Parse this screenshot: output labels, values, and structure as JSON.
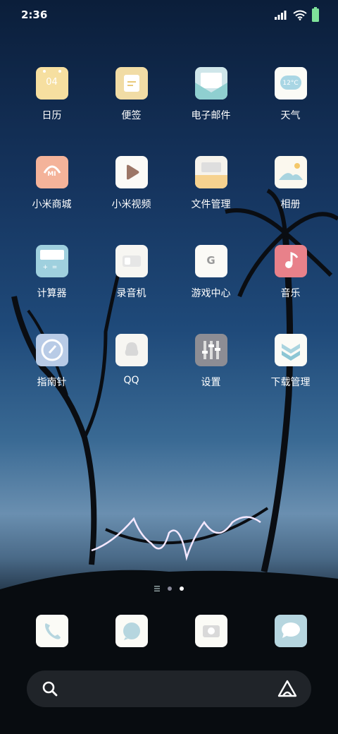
{
  "status": {
    "time": "2:36"
  },
  "apps": [
    {
      "label": "日历",
      "icon": "calendar-icon",
      "bg": "#f6dfa0",
      "text": "04"
    },
    {
      "label": "便签",
      "icon": "notes-icon",
      "bg": "#f1dca5"
    },
    {
      "label": "电子邮件",
      "icon": "email-icon",
      "bg": "#cfe6ea"
    },
    {
      "label": "天气",
      "icon": "weather-icon",
      "bg": "#fbfbf6",
      "text": "12°C"
    },
    {
      "label": "小米商城",
      "icon": "mi-store-icon",
      "bg": "#f4b39a",
      "text": "MI"
    },
    {
      "label": "小米视频",
      "icon": "mi-video-icon",
      "bg": "#fbfaf6"
    },
    {
      "label": "文件管理",
      "icon": "file-manager-icon",
      "bg": "#f6f3ec"
    },
    {
      "label": "相册",
      "icon": "gallery-icon",
      "bg": "#fbf8ee"
    },
    {
      "label": "计算器",
      "icon": "calculator-icon",
      "bg": "#9fd0de"
    },
    {
      "label": "录音机",
      "icon": "recorder-icon",
      "bg": "#f7f6f2"
    },
    {
      "label": "游戏中心",
      "icon": "game-center-icon",
      "bg": "#fbfaf6",
      "text": "G"
    },
    {
      "label": "音乐",
      "icon": "music-icon",
      "bg": "#e8818a"
    },
    {
      "label": "指南针",
      "icon": "compass-icon",
      "bg": "#b8cbe6"
    },
    {
      "label": "QQ",
      "icon": "qq-icon",
      "bg": "#f7f6f2"
    },
    {
      "label": "设置",
      "icon": "settings-icon",
      "bg": "#8d8d94"
    },
    {
      "label": "下载管理",
      "icon": "download-icon",
      "bg": "#fbfbf6"
    }
  ],
  "dock": [
    {
      "icon": "phone-icon",
      "bg": "#fbfbf6"
    },
    {
      "icon": "messages-icon",
      "bg": "#fbfbf6"
    },
    {
      "icon": "camera-icon",
      "bg": "#fbfbf6"
    },
    {
      "icon": "chat-icon",
      "bg": "#b6d6df"
    }
  ]
}
